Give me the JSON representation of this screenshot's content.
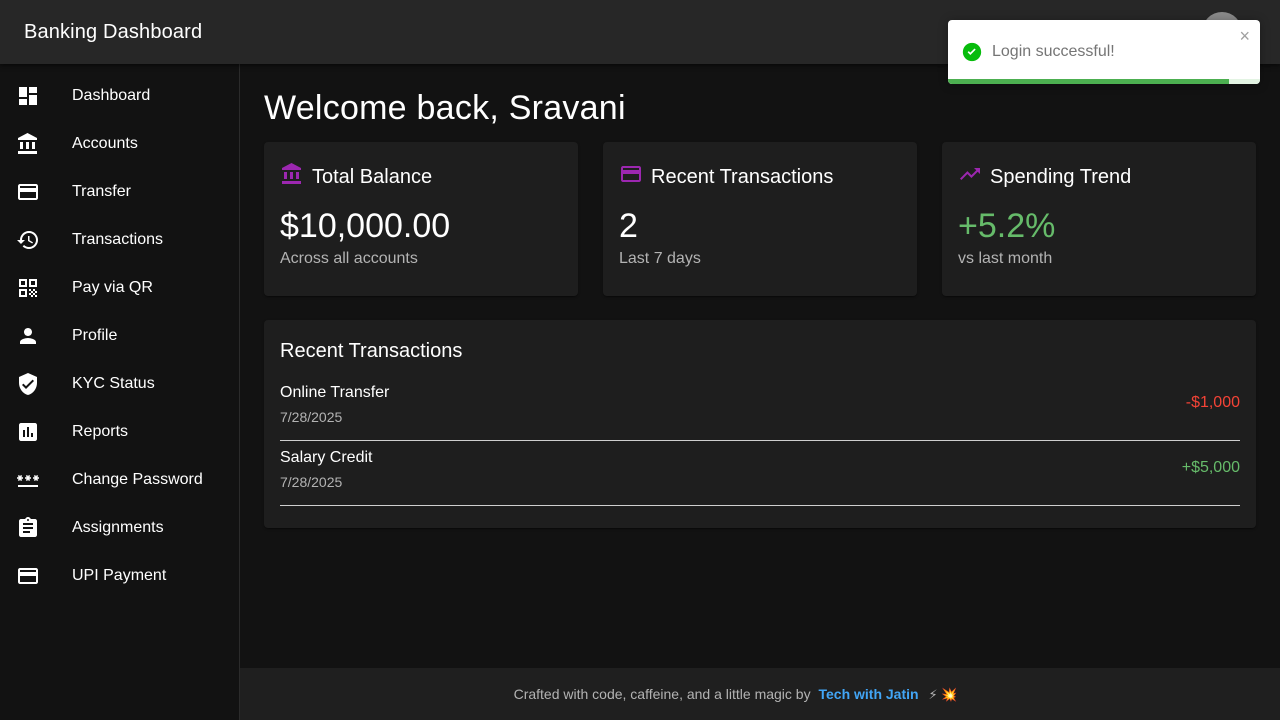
{
  "appbar": {
    "title": "Banking Dashboard"
  },
  "sidebar": {
    "items": [
      {
        "label": "Dashboard",
        "icon": "dashboard-icon"
      },
      {
        "label": "Accounts",
        "icon": "bank-icon"
      },
      {
        "label": "Transfer",
        "icon": "credit-card-icon"
      },
      {
        "label": "Transactions",
        "icon": "history-icon"
      },
      {
        "label": "Pay via QR",
        "icon": "qr-code-icon"
      },
      {
        "label": "Profile",
        "icon": "person-icon"
      },
      {
        "label": "KYC Status",
        "icon": "verified-shield-icon"
      },
      {
        "label": "Reports",
        "icon": "bar-chart-icon"
      },
      {
        "label": "Change Password",
        "icon": "password-icon"
      },
      {
        "label": "Assignments",
        "icon": "clipboard-icon"
      },
      {
        "label": "UPI Payment",
        "icon": "credit-card-icon"
      }
    ]
  },
  "main": {
    "welcome": "Welcome back, Sravani",
    "cards": [
      {
        "title": "Total Balance",
        "value": "$10,000.00",
        "subtitle": "Across all accounts",
        "icon": "bank-icon"
      },
      {
        "title": "Recent Transactions",
        "value": "2",
        "subtitle": "Last 7 days",
        "icon": "credit-card-icon"
      },
      {
        "title": "Spending Trend",
        "value": "+5.2%",
        "subtitle": "vs last month",
        "icon": "trending-up-icon"
      }
    ],
    "transactions": {
      "title": "Recent Transactions",
      "rows": [
        {
          "name": "Online Transfer",
          "date": "7/28/2025",
          "amount": "-$1,000"
        },
        {
          "name": "Salary Credit",
          "date": "7/28/2025",
          "amount": "+$5,000"
        }
      ]
    }
  },
  "footer": {
    "text": "Crafted with code, caffeine, and a little magic by",
    "link": "Tech with Jatin",
    "emoji": "⚡ 💥"
  },
  "toast": {
    "message": "Login successful!",
    "close": "×",
    "progress": 0.9
  },
  "colors": {
    "accent": "#9c27b0",
    "positive": "#66bb6a",
    "negative": "#f44336",
    "link": "#42a5f5",
    "success": "#4caf50"
  }
}
